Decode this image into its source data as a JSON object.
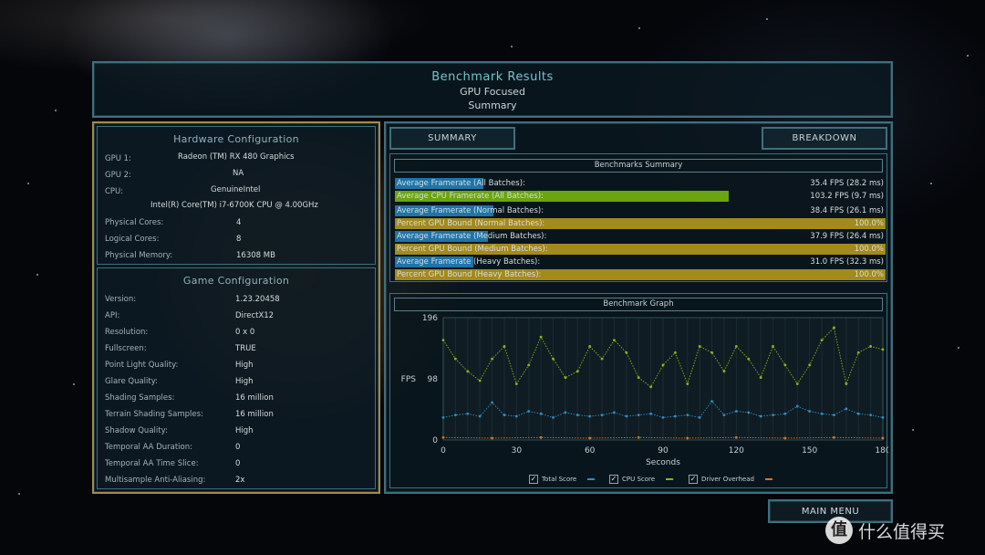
{
  "header": {
    "title": "Benchmark Results",
    "subtitle": "GPU Focused",
    "view": "Summary"
  },
  "hardware": {
    "title": "Hardware Configuration",
    "rows": [
      {
        "label": "GPU 1:",
        "value": "Radeon (TM) RX 480 Graphics"
      },
      {
        "label": "GPU 2:",
        "value": "NA"
      },
      {
        "label": "CPU:",
        "value": "GenuineIntel"
      },
      {
        "label": "",
        "value": "Intel(R) Core(TM) i7-6700K CPU @ 4.00GHz"
      },
      {
        "label": "Physical Cores:",
        "value": "4"
      },
      {
        "label": "Logical Cores:",
        "value": "8"
      },
      {
        "label": "Physical Memory:",
        "value": "16308  MB"
      }
    ]
  },
  "game": {
    "title": "Game Configuration",
    "rows": [
      {
        "label": "Version:",
        "value": "1.23.20458"
      },
      {
        "label": "API:",
        "value": "DirectX12"
      },
      {
        "label": "Resolution:",
        "value": "0 x 0"
      },
      {
        "label": "Fullscreen:",
        "value": "TRUE"
      },
      {
        "label": "Point Light Quality:",
        "value": "High"
      },
      {
        "label": "Glare Quality:",
        "value": "High"
      },
      {
        "label": "Shading Samples:",
        "value": "16 million"
      },
      {
        "label": "Terrain Shading Samples:",
        "value": "16 million"
      },
      {
        "label": "Shadow Quality:",
        "value": "High"
      },
      {
        "label": "Temporal AA Duration:",
        "value": "0"
      },
      {
        "label": "Temporal AA Time Slice:",
        "value": "0"
      },
      {
        "label": "Multisample Anti-Aliasing:",
        "value": "2x"
      }
    ]
  },
  "tabs": {
    "summary": "SUMMARY",
    "breakdown": "BREAKDOWN"
  },
  "summary_box": {
    "title": "Benchmarks Summary",
    "rows": [
      {
        "label": "Average Framerate (All Batches):",
        "value": "35.4 FPS (28.2 ms)",
        "color": "#1f74a8",
        "fill": 0.18
      },
      {
        "label": "Average CPU Framerate (All Batches):",
        "value": "103.2 FPS (9.7 ms)",
        "color": "#6aa510",
        "fill": 0.68
      },
      {
        "label": "Average Framerate (Normal Batches):",
        "value": "38.4 FPS (26.1 ms)",
        "color": "#1f74a8",
        "fill": 0.2
      },
      {
        "label": "Percent GPU Bound (Normal Batches):",
        "value": "100.0%",
        "color": "#a38a1c",
        "fill": 1.0
      },
      {
        "label": "Average Framerate (Medium Batches):",
        "value": "37.9 FPS (26.4 ms)",
        "color": "#1f74a8",
        "fill": 0.19
      },
      {
        "label": "Percent GPU Bound (Medium Batches):",
        "value": "100.0%",
        "color": "#a38a1c",
        "fill": 1.0
      },
      {
        "label": "Average Framerate (Heavy Batches):",
        "value": "31.0 FPS (32.3 ms)",
        "color": "#1f74a8",
        "fill": 0.16
      },
      {
        "label": "Percent GPU Bound (Heavy Batches):",
        "value": "100.0%",
        "color": "#a38a1c",
        "fill": 1.0
      }
    ]
  },
  "graph_box": {
    "title": "Benchmark Graph"
  },
  "chart_data": {
    "type": "scatter",
    "xlabel": "Seconds",
    "ylabel": "FPS",
    "xlim": [
      0,
      180
    ],
    "ylim": [
      0,
      196
    ],
    "x_ticks": [
      0,
      30,
      60,
      90,
      120,
      150,
      180
    ],
    "y_ticks": [
      0,
      98,
      196
    ],
    "series": [
      {
        "name": "Total Score",
        "color": "#2f8ec4",
        "x": [
          0,
          5,
          10,
          15,
          20,
          25,
          30,
          35,
          40,
          45,
          50,
          55,
          60,
          65,
          70,
          75,
          80,
          85,
          90,
          95,
          100,
          105,
          110,
          115,
          120,
          125,
          130,
          135,
          140,
          145,
          150,
          155,
          160,
          165,
          170,
          175,
          180
        ],
        "values": [
          36,
          40,
          42,
          38,
          60,
          40,
          38,
          46,
          42,
          36,
          44,
          40,
          38,
          40,
          44,
          38,
          40,
          42,
          36,
          38,
          40,
          36,
          62,
          40,
          46,
          44,
          38,
          40,
          42,
          54,
          46,
          42,
          40,
          50,
          42,
          40,
          36
        ]
      },
      {
        "name": "CPU Score",
        "color": "#8bb51a",
        "x": [
          0,
          5,
          10,
          15,
          20,
          25,
          30,
          35,
          40,
          45,
          50,
          55,
          60,
          65,
          70,
          75,
          80,
          85,
          90,
          95,
          100,
          105,
          110,
          115,
          120,
          125,
          130,
          135,
          140,
          145,
          150,
          155,
          160,
          165,
          170,
          175,
          180
        ],
        "values": [
          160,
          130,
          110,
          95,
          130,
          150,
          90,
          120,
          165,
          130,
          100,
          110,
          150,
          130,
          160,
          140,
          100,
          85,
          120,
          140,
          90,
          150,
          140,
          110,
          150,
          130,
          100,
          150,
          120,
          90,
          120,
          160,
          180,
          90,
          140,
          150,
          145
        ]
      },
      {
        "name": "Driver Overhead",
        "color": "#d0762a",
        "x": [
          0,
          20,
          40,
          60,
          80,
          100,
          120,
          140,
          160,
          180
        ],
        "values": [
          4,
          3,
          4,
          3,
          4,
          3,
          4,
          3,
          4,
          3
        ]
      }
    ],
    "grid": true,
    "legend": "bottom"
  },
  "legend": [
    {
      "label": "Total Score",
      "color": "#2f8ec4"
    },
    {
      "label": "CPU Score",
      "color": "#8bb51a"
    },
    {
      "label": "Driver Overhead",
      "color": "#d0762a"
    }
  ],
  "main_menu": "MAIN MENU",
  "watermark": {
    "badge": "值",
    "text": "什么值得买"
  }
}
